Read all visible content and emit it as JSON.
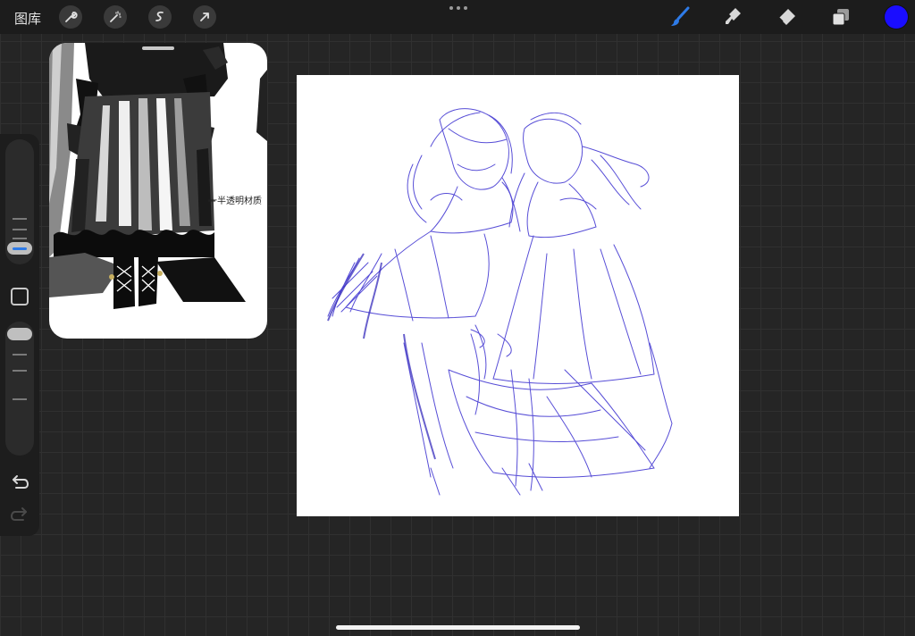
{
  "topbar": {
    "gallery_label": "图库",
    "left_tools": [
      "wrench-icon",
      "magic-wand-icon",
      "selection-icon",
      "transform-arrow-icon"
    ],
    "right_tools": [
      "brush-icon",
      "smudge-icon",
      "eraser-icon",
      "layers-icon"
    ],
    "active_tool": "brush-icon",
    "current_color": "#1a0dff"
  },
  "sidebar": {
    "brush_size_slider": "brush-size",
    "opacity_slider": "opacity",
    "undo_icon": "undo-icon",
    "redo_icon": "redo-icon"
  },
  "reference": {
    "annotation_text": "一半透明材质"
  },
  "colors": {
    "accent_blue": "#2e7be8",
    "sketch_stroke": "#3a2fd0"
  }
}
